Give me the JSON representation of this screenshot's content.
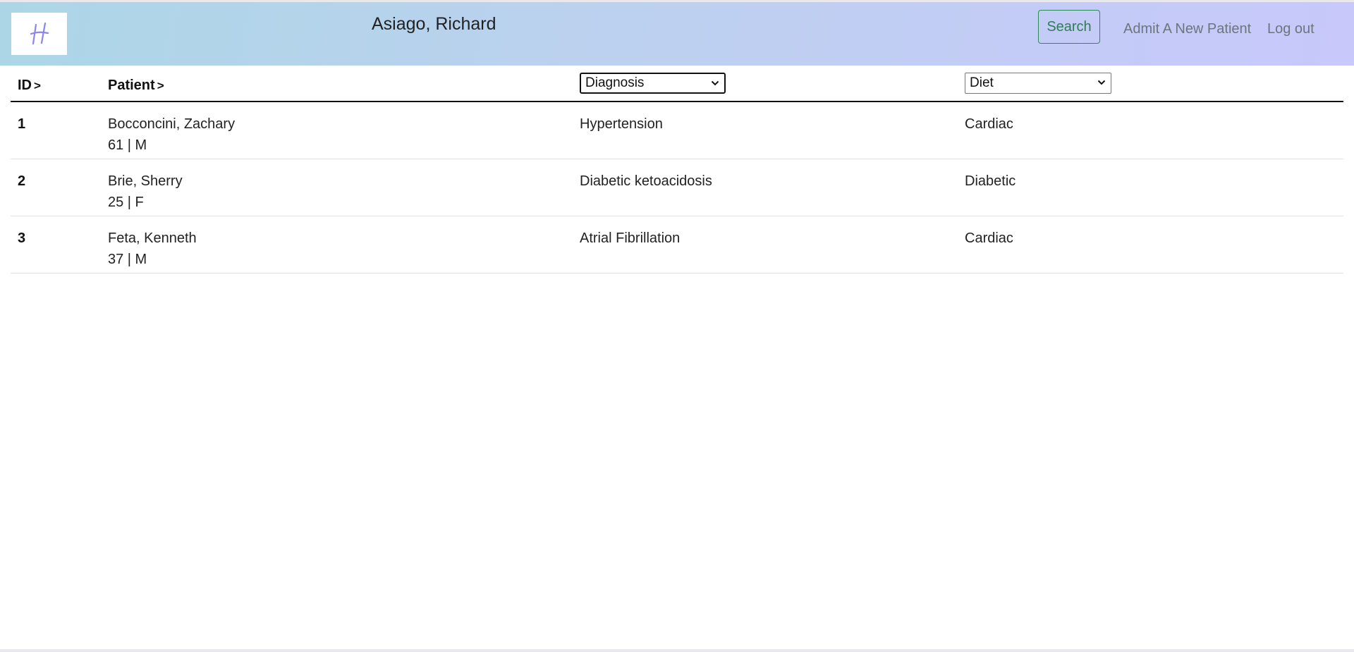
{
  "header": {
    "logo_letter": "H",
    "user_name": "Asiago, Richard",
    "search_label": "Search",
    "admit_label": "Admit A New Patient",
    "logout_label": "Log out",
    "accent_color": "#2e8b57"
  },
  "table": {
    "columns": {
      "id": "ID",
      "patient": "Patient",
      "sort_indicator": ">",
      "diagnosis_select": "Diagnosis",
      "diet_select": "Diet"
    },
    "rows": [
      {
        "id": "1",
        "name": "Bocconcini, Zachary",
        "info": "61 | M",
        "diagnosis": "Hypertension",
        "diet": "Cardiac"
      },
      {
        "id": "2",
        "name": "Brie, Sherry",
        "info": "25 | F",
        "diagnosis": "Diabetic ketoacidosis",
        "diet": "Diabetic"
      },
      {
        "id": "3",
        "name": "Feta, Kenneth",
        "info": "37 | M",
        "diagnosis": "Atrial Fibrillation",
        "diet": "Cardiac"
      }
    ]
  }
}
